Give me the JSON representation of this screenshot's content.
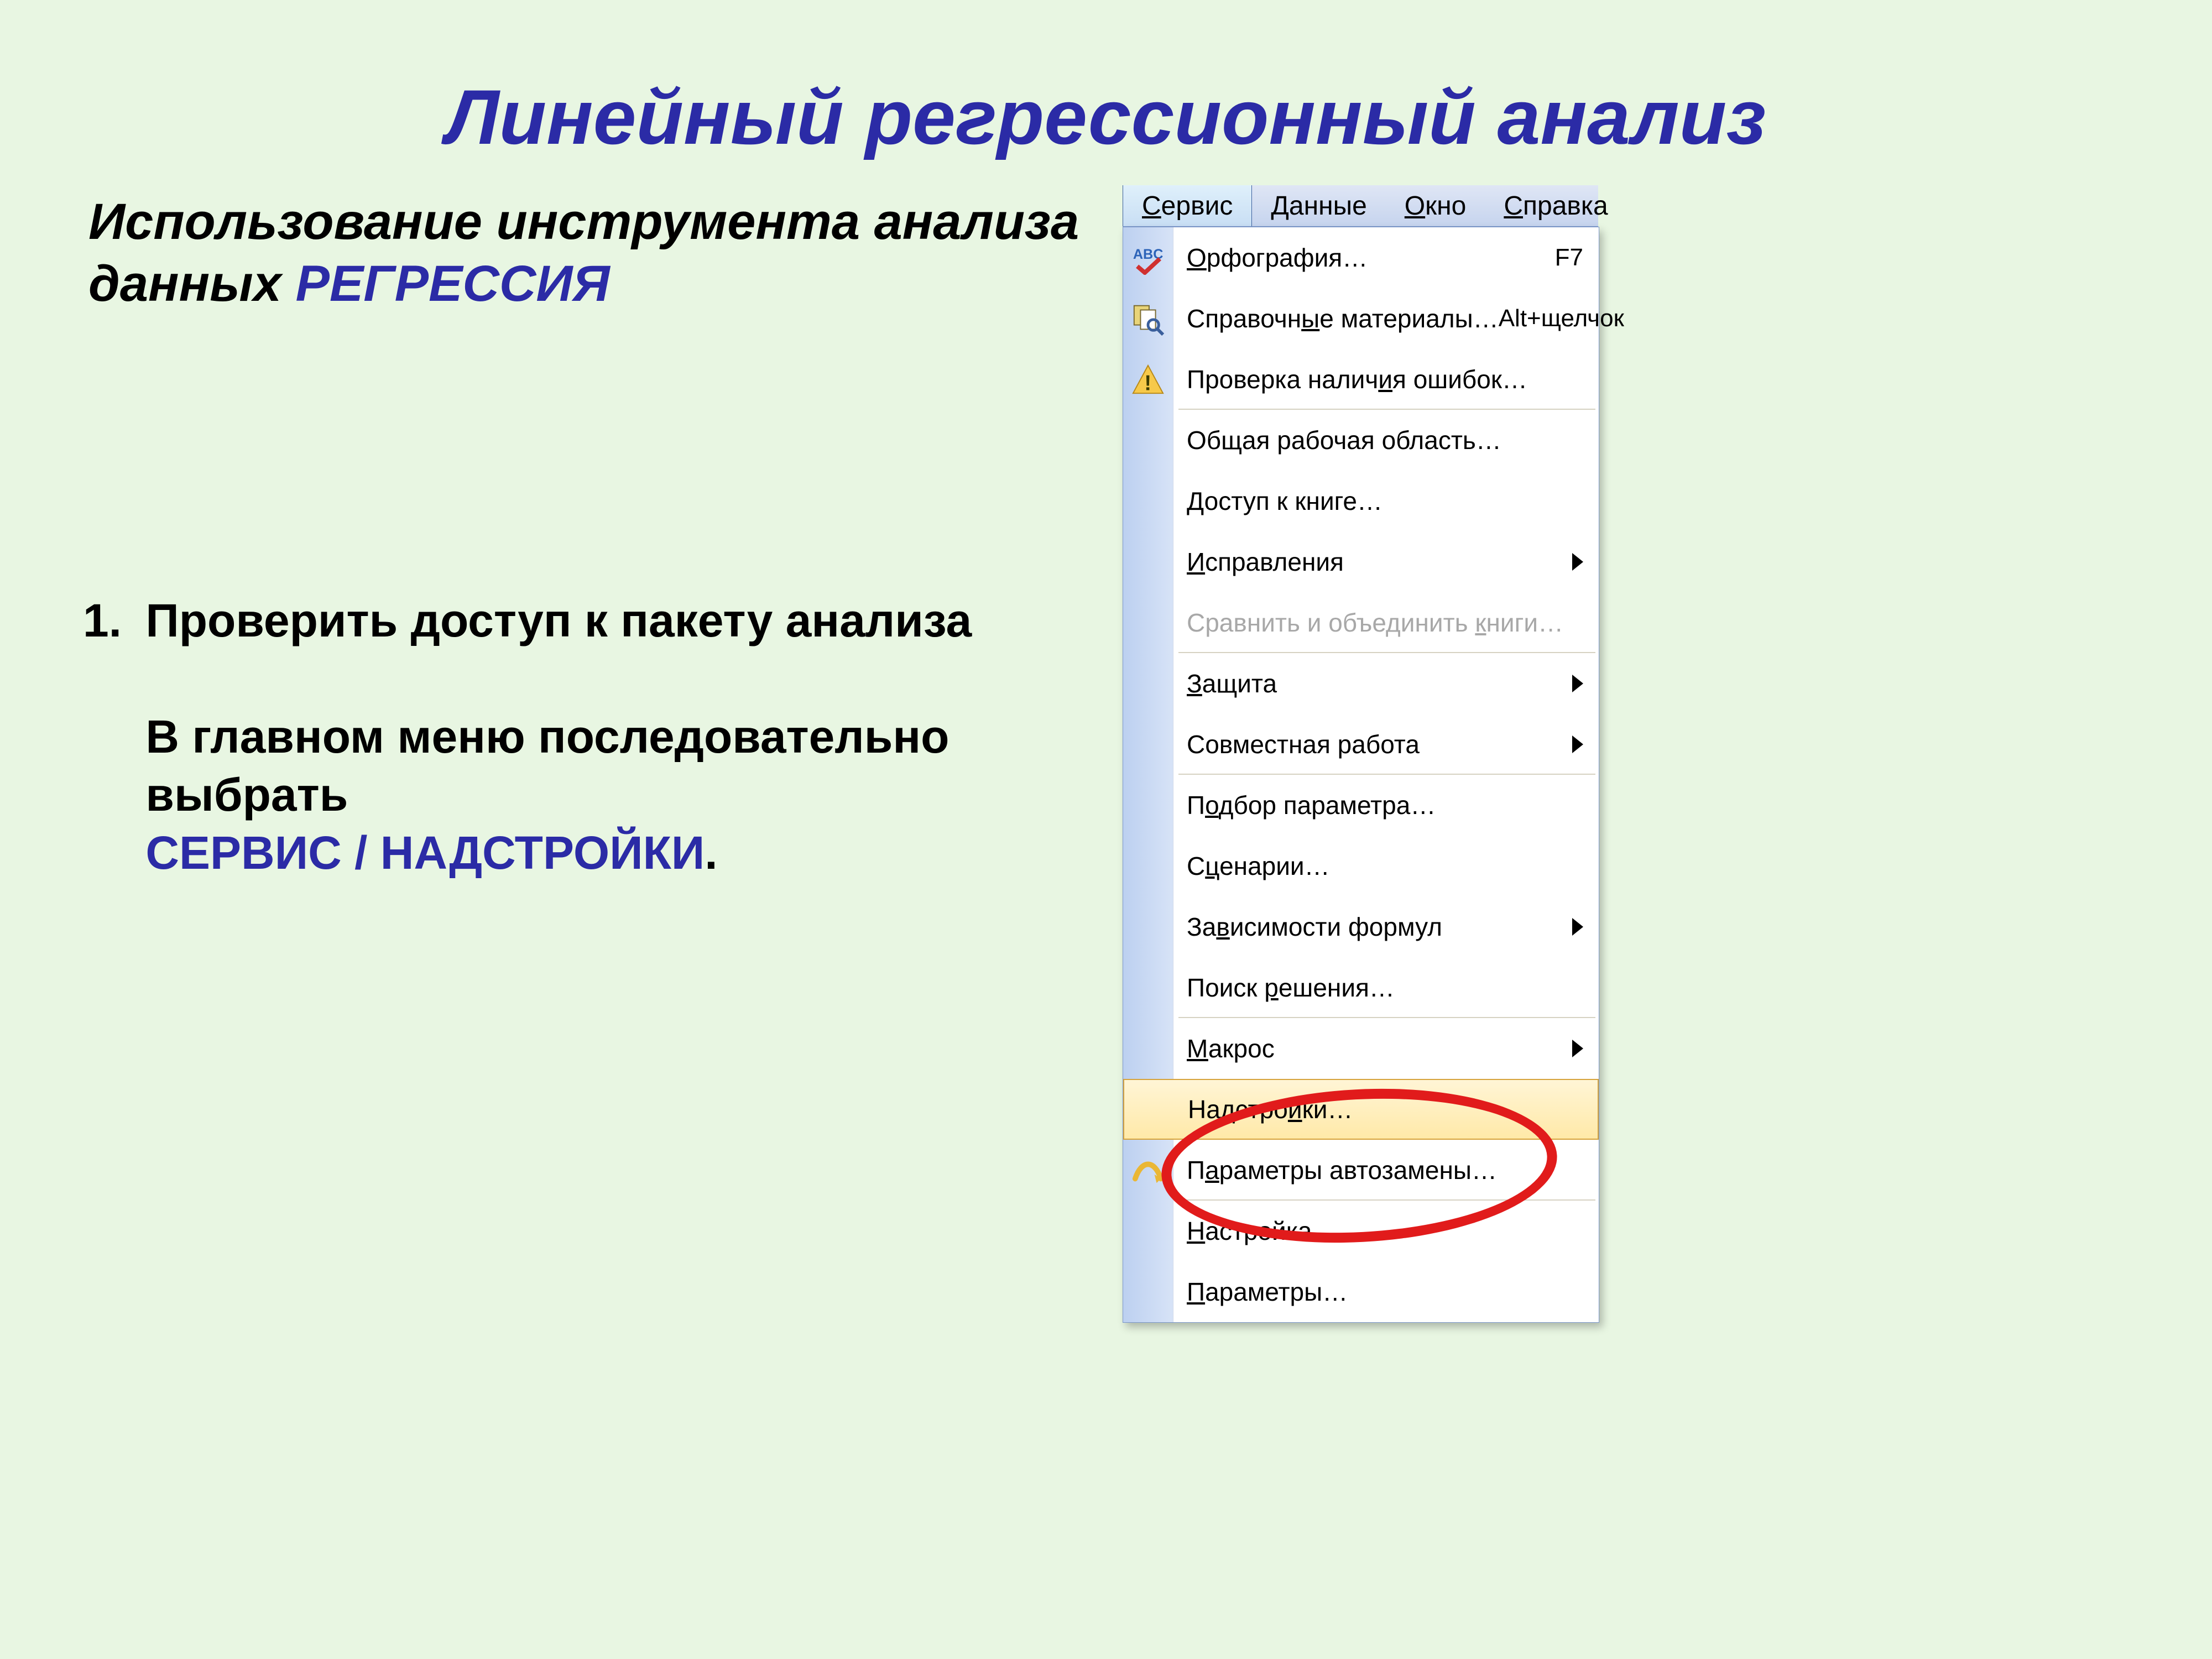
{
  "title": "Линейный регрессионный анализ",
  "subtitle_a": "Использование инструмента анализа данных ",
  "subtitle_b": "РЕГРЕССИЯ",
  "step_num": "1.",
  "step_line1": "Проверить доступ к пакету анализа",
  "step_para_a": "В главном меню последовательно выбрать",
  "step_path": "СЕРВИС / НАДСТРОЙКИ",
  "step_dot": ".",
  "menubar": {
    "service": "Сервис",
    "data": "Данные",
    "window": "Окно",
    "help": "Справка",
    "service_u": "С",
    "data_u": "Д",
    "window_u": "О",
    "help_u": "С",
    "service_rest": "ервис",
    "data_rest": "анные",
    "window_rest": "кно",
    "help_rest": "правка"
  },
  "menu": {
    "spelling": {
      "label": "Орфография…",
      "shortcut": "F7",
      "u_i": 0
    },
    "research": {
      "label": "Справочные материалы…",
      "shortcut": "Alt+щелчок",
      "u_i": 8
    },
    "errorcheck": {
      "label": "Проверка наличия ошибок…",
      "u_i": 14
    },
    "sharedws": {
      "label": "Общая рабочая область…",
      "u_i": -1
    },
    "sharebook": {
      "label": "Доступ к книге…",
      "u_i": 0
    },
    "trackchanges": {
      "label": "Исправления",
      "u_i": 0,
      "sub": true
    },
    "compare": {
      "label": "Сравнить и объединить книги…",
      "u_i": 22,
      "disabled": true
    },
    "protection": {
      "label": "Защита",
      "u_i": 0,
      "sub": true
    },
    "collab": {
      "label": "Совместная работа",
      "u_i": -1,
      "sub": true
    },
    "goalseek": {
      "label": "Подбор параметра…",
      "u_i": 1
    },
    "scenarios": {
      "label": "Сценарии…",
      "u_i": 1
    },
    "auditing": {
      "label": "Зависимости формул",
      "u_i": 2,
      "sub": true
    },
    "solver": {
      "label": "Поиск решения…",
      "u_i": 6
    },
    "macro": {
      "label": "Макрос",
      "u_i": 0,
      "sub": true
    },
    "addins": {
      "label": "Надстройки…",
      "u_i": 7,
      "highlight": true
    },
    "autocorrect": {
      "label": "Параметры автозамены…",
      "u_i": 1
    },
    "customize": {
      "label": "Настройка…",
      "u_i": 0
    },
    "options": {
      "label": "Параметры…",
      "u_i": 0
    }
  }
}
